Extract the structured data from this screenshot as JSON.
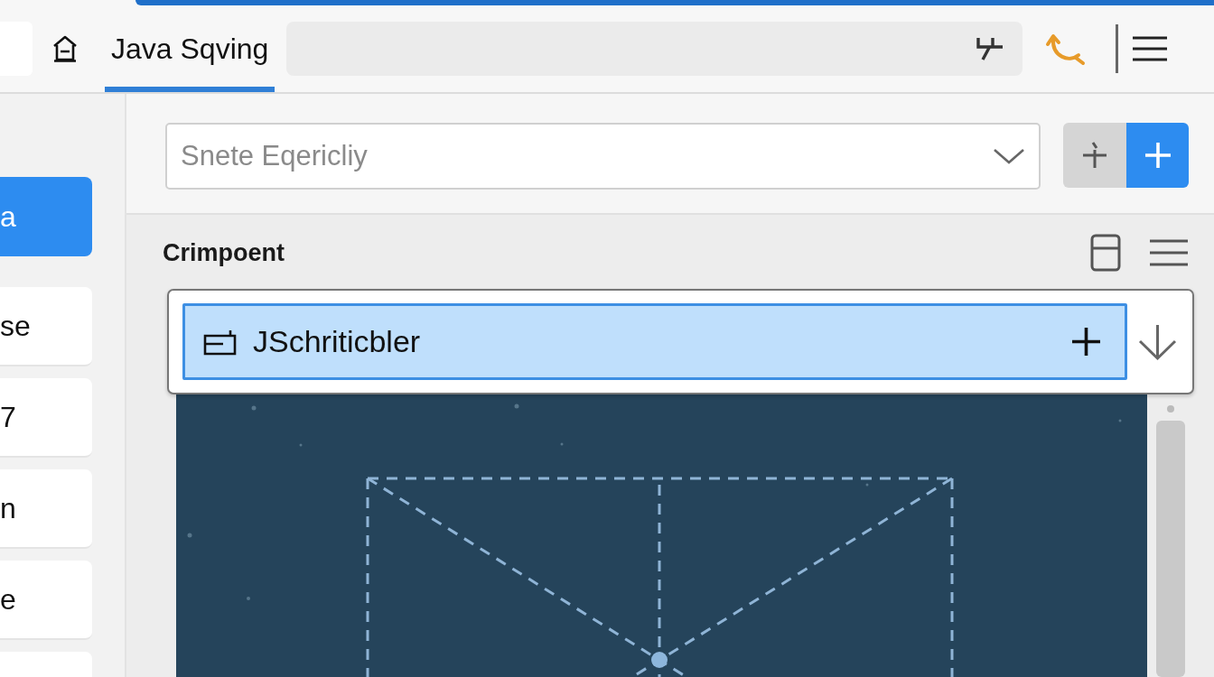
{
  "top_bar": {
    "tabs": [
      {
        "label": "Java Sqving",
        "selected": true
      }
    ]
  },
  "sidebar": {
    "items": [
      {
        "label": "a",
        "selected": true
      },
      {
        "label": "se",
        "selected": false
      },
      {
        "label": "7",
        "selected": false
      },
      {
        "label": "n",
        "selected": false
      },
      {
        "label": "e",
        "selected": false
      },
      {
        "selected": false
      }
    ]
  },
  "selector": {
    "placeholder": "Snete Eqericliy"
  },
  "component_panel": {
    "title": "Crimpoent",
    "dropdown": {
      "items": [
        {
          "label": "JSchriticbler",
          "selected": true
        }
      ]
    }
  }
}
